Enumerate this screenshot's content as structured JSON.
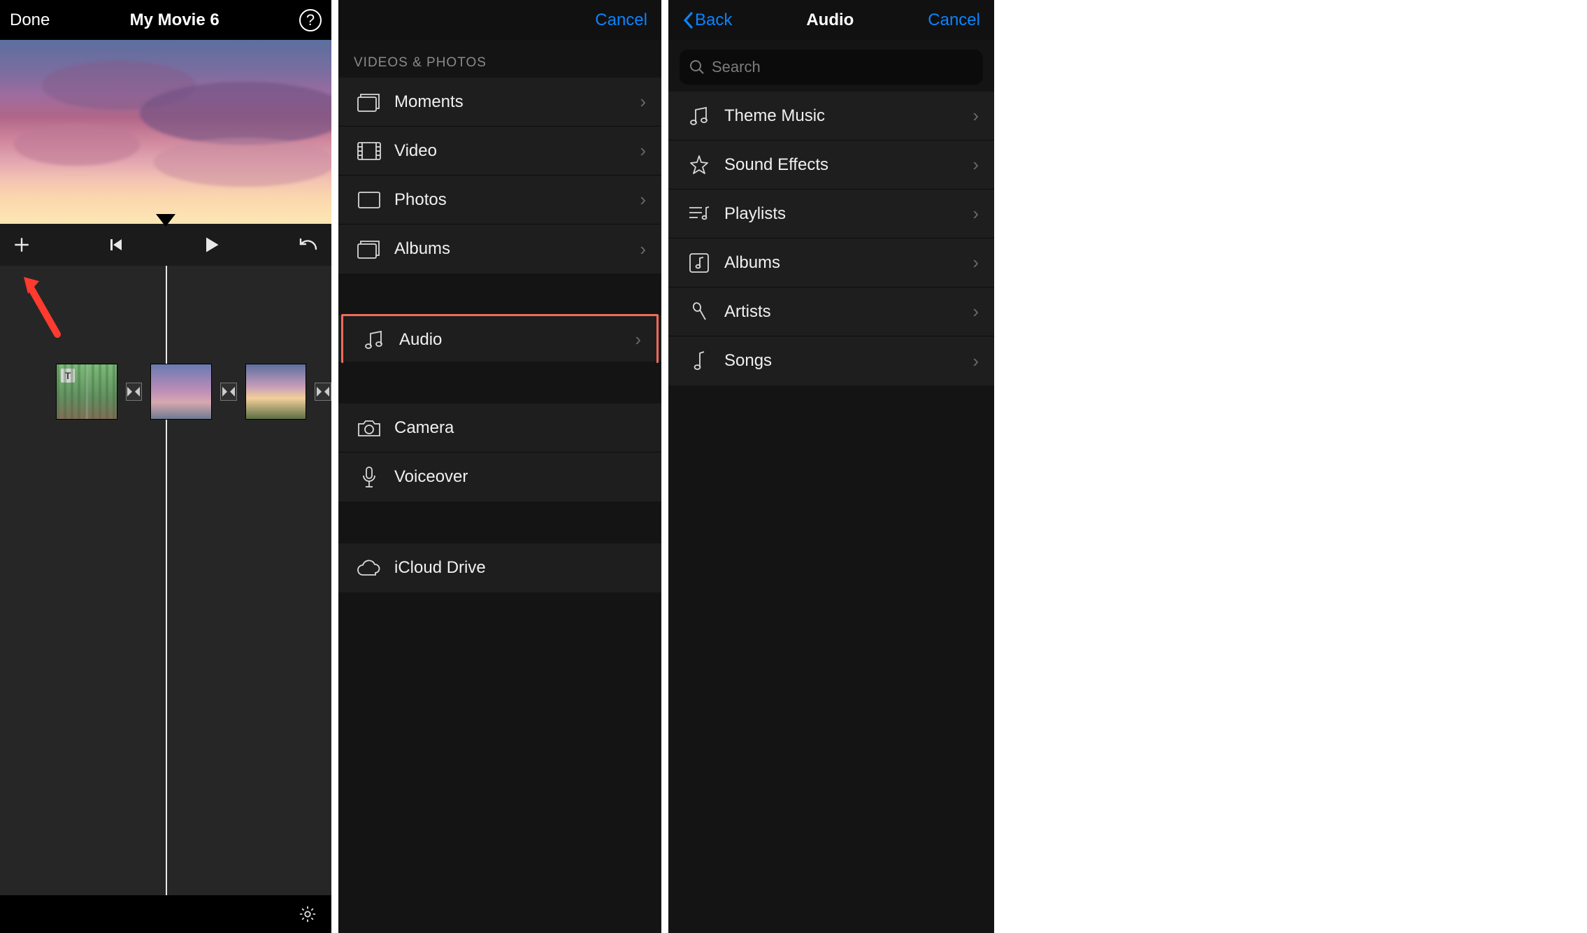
{
  "panel1": {
    "done_label": "Done",
    "title": "My Movie 6",
    "title_badge": "T"
  },
  "panel2": {
    "cancel_label": "Cancel",
    "section_header": "Videos & Photos",
    "rows_media": [
      {
        "label": "Moments",
        "icon": "moments"
      },
      {
        "label": "Video",
        "icon": "video"
      },
      {
        "label": "Photos",
        "icon": "photos"
      },
      {
        "label": "Albums",
        "icon": "albums"
      }
    ],
    "row_audio": {
      "label": "Audio",
      "icon": "audio"
    },
    "rows_capture": [
      {
        "label": "Camera",
        "icon": "camera"
      },
      {
        "label": "Voiceover",
        "icon": "voiceover"
      }
    ],
    "row_icloud": {
      "label": "iCloud Drive",
      "icon": "icloud"
    }
  },
  "panel3": {
    "back_label": "Back",
    "title": "Audio",
    "cancel_label": "Cancel",
    "search_placeholder": "Search",
    "rows": [
      {
        "label": "Theme Music",
        "icon": "theme"
      },
      {
        "label": "Sound Effects",
        "icon": "fx"
      },
      {
        "label": "Playlists",
        "icon": "playlist"
      },
      {
        "label": "Albums",
        "icon": "album"
      },
      {
        "label": "Artists",
        "icon": "artist"
      },
      {
        "label": "Songs",
        "icon": "song"
      }
    ]
  },
  "colors": {
    "accent": "#0a84ff",
    "highlight": "#f36a5a"
  }
}
